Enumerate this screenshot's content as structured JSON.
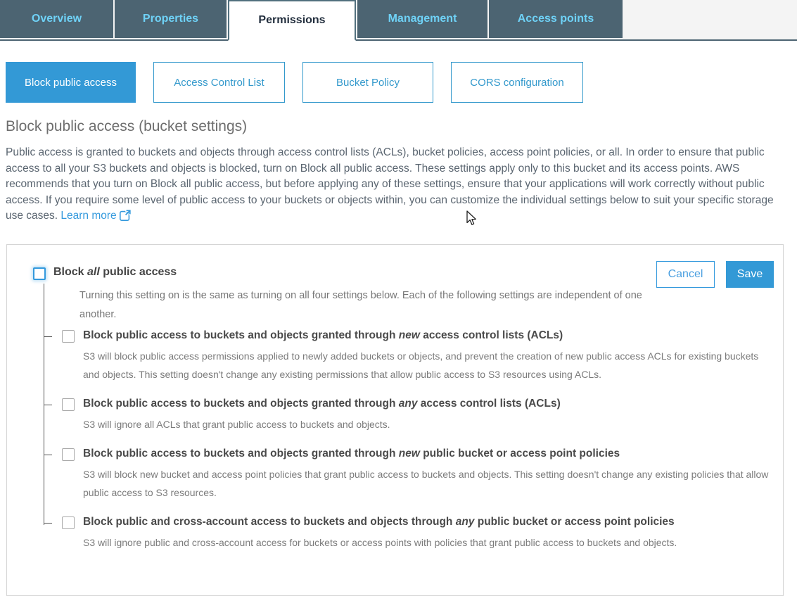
{
  "tabs": [
    {
      "label": "Overview",
      "active": false
    },
    {
      "label": "Properties",
      "active": false
    },
    {
      "label": "Permissions",
      "active": true
    },
    {
      "label": "Management",
      "active": false
    },
    {
      "label": "Access points",
      "active": false
    }
  ],
  "subnav": [
    {
      "label": "Block public access",
      "active": true
    },
    {
      "label": "Access Control List",
      "active": false
    },
    {
      "label": "Bucket Policy",
      "active": false
    },
    {
      "label": "CORS configuration",
      "active": false
    }
  ],
  "page": {
    "title": "Block public access (bucket settings)",
    "intro_part1": "Public access is granted to buckets and objects through access control lists (ACLs), bucket policies, access point policies, or all. In order to ensure that public access to all your S3 buckets and objects is blocked, turn on Block all public access. These settings apply only to this bucket and its access points. AWS recommends that you turn on Block all public access, but before applying any of these settings, ensure that your applications will work correctly without public access. If you require some level of public access to your buckets or objects within, you can customize the individual settings below to suit your specific storage use cases. ",
    "learn_more": "Learn more"
  },
  "panel": {
    "main_setting": {
      "label_before": "Block ",
      "label_italic": "all",
      "label_after": " public access",
      "description": "Turning this setting on is the same as turning on all four settings below. Each of the following settings are independent of one another.",
      "checked": false
    },
    "buttons": {
      "cancel": "Cancel",
      "save": "Save"
    },
    "settings": [
      {
        "label_before": "Block public access to buckets and objects granted through ",
        "label_italic": "new",
        "label_after": " access control lists (ACLs)",
        "description": "S3 will block public access permissions applied to newly added buckets or objects, and prevent the creation of new public access ACLs for existing buckets and objects. This setting doesn't change any existing permissions that allow public access to S3 resources using ACLs.",
        "checked": false
      },
      {
        "label_before": "Block public access to buckets and objects granted through ",
        "label_italic": "any",
        "label_after": " access control lists (ACLs)",
        "description": "S3 will ignore all ACLs that grant public access to buckets and objects.",
        "checked": false
      },
      {
        "label_before": "Block public access to buckets and objects granted through ",
        "label_italic": "new",
        "label_after": " public bucket or access point policies",
        "description": "S3 will block new bucket and access point policies that grant public access to buckets and objects. This setting doesn't change any existing policies that allow public access to S3 resources.",
        "checked": false
      },
      {
        "label_before": "Block public and cross-account access to buckets and objects through ",
        "label_italic": "any",
        "label_after": " public bucket or access point policies",
        "description": "S3 will ignore public and cross-account access for buckets or access points with policies that grant public access to buckets and objects.",
        "checked": false
      }
    ]
  },
  "colors": {
    "tab_bar": "#4c6472",
    "tab_text": "#6fd2f7",
    "accent_blue": "#3399d6",
    "link_blue": "#3399dd",
    "heading_gray": "#6e6e6e"
  }
}
